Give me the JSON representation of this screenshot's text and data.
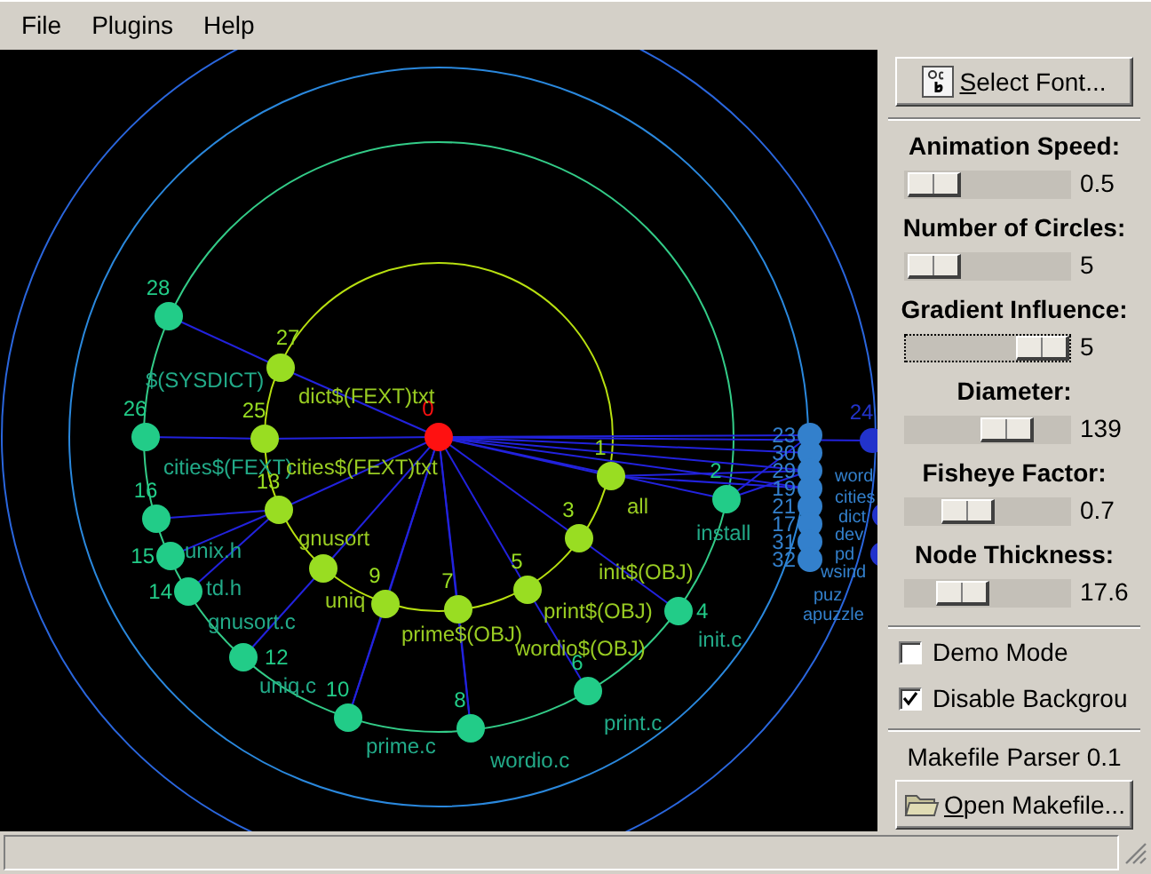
{
  "menu": [
    {
      "label": "File"
    },
    {
      "label": "Plugins"
    },
    {
      "label": "Help"
    }
  ],
  "graph": {
    "nodes": [
      {
        "number": "0",
        "color": "#ff1111"
      },
      {
        "number": "28",
        "color": "#22cc88"
      },
      {
        "number": "27",
        "color": "#99dd22"
      },
      {
        "number": "26",
        "color": "#22cc88"
      },
      {
        "number": "25",
        "color": "#99dd22"
      },
      {
        "number": "13",
        "color": "#99dd22"
      },
      {
        "number": "16",
        "color": "#22cc88"
      },
      {
        "number": "15",
        "color": "#22cc88"
      },
      {
        "number": "14",
        "color": "#22cc88"
      },
      {
        "color": "#99dd22"
      },
      {
        "number": "12",
        "color": "#22cc88"
      },
      {
        "number": "9",
        "color": "#99dd22"
      },
      {
        "number": "7",
        "color": "#99dd22"
      },
      {
        "number": "5",
        "color": "#99dd22"
      },
      {
        "number": "3",
        "color": "#99dd22"
      },
      {
        "number": "1",
        "color": "#99dd22"
      },
      {
        "number": "2",
        "color": "#22cc88"
      },
      {
        "number": "4",
        "color": "#22cc88"
      },
      {
        "number": "6",
        "color": "#22cc88"
      },
      {
        "number": "8",
        "color": "#22cc88"
      },
      {
        "number": "10",
        "color": "#22cc88"
      },
      {
        "number": "23",
        "color": "#3380cc"
      },
      {
        "number": "30",
        "color": "#3380cc"
      },
      {
        "number": "29",
        "color": "#3380cc"
      },
      {
        "number": "19",
        "color": "#3380cc"
      },
      {
        "number": "21",
        "color": "#3380cc"
      },
      {
        "number": "17",
        "color": "#3380cc"
      },
      {
        "number": "31",
        "color": "#3380cc"
      },
      {
        "number": "32",
        "color": "#3380cc"
      },
      {
        "number": "24",
        "color": "#2233cc"
      },
      {
        "color": "#2233cc"
      },
      {
        "color": "#2233cc"
      }
    ],
    "labels": [
      {
        "text": "$(SYSDICT)",
        "color": "#22aa88"
      },
      {
        "text": "dict$(FEXT)txt",
        "color": "#99cc22"
      },
      {
        "text": "cities$(FEXT)",
        "color": "#22aa88"
      },
      {
        "text": "cities$(FEXT)txt",
        "color": "#99cc22"
      },
      {
        "text": "unix.h",
        "color": "#22aa88"
      },
      {
        "text": "td.h",
        "color": "#22aa88"
      },
      {
        "text": "gnusort",
        "color": "#99cc22"
      },
      {
        "text": "gnusort.c",
        "color": "#22aa88"
      },
      {
        "text": "uniq",
        "color": "#99cc22"
      },
      {
        "text": "uniq.c",
        "color": "#22aa88"
      },
      {
        "text": "all",
        "color": "#99cc22"
      },
      {
        "text": "init$(OBJ)",
        "color": "#99cc22"
      },
      {
        "text": "print$(OBJ)",
        "color": "#99cc22"
      },
      {
        "text": "prime$(OBJ)",
        "color": "#99cc22"
      },
      {
        "text": "wordio$(OBJ)",
        "color": "#99cc22"
      },
      {
        "text": "install",
        "color": "#22aa88"
      },
      {
        "text": "init.c",
        "color": "#22aa88"
      },
      {
        "text": "print.c",
        "color": "#22aa88"
      },
      {
        "text": "wordio.c",
        "color": "#22aa88"
      },
      {
        "text": "prime.c",
        "color": "#22aa88"
      },
      {
        "text": "word",
        "color": "#3380cc"
      },
      {
        "text": "cities",
        "color": "#3380cc"
      },
      {
        "text": "dict",
        "color": "#3380cc"
      },
      {
        "text": "dev",
        "color": "#3380cc"
      },
      {
        "text": "pd",
        "color": "#3380cc"
      },
      {
        "text": "wsind",
        "color": "#3380cc"
      },
      {
        "text": "puz",
        "color": "#3380cc"
      },
      {
        "text": "apuzzle",
        "color": "#3380cc"
      }
    ]
  },
  "panel": {
    "font_button": "Select Font...",
    "sliders": [
      {
        "label": "Animation Speed:",
        "level": 0.02,
        "reading": "0.5",
        "focused": false
      },
      {
        "label": "Number of Circles:",
        "level": 0.02,
        "reading": "5",
        "focused": false
      },
      {
        "label": "Gradient Influence:",
        "level": 1,
        "reading": "5",
        "focused": true
      },
      {
        "label": "Diameter:",
        "level": 0.68,
        "reading": "139",
        "focused": false
      },
      {
        "label": "Fisheye Factor:",
        "level": 0.32,
        "reading": "0.7",
        "focused": false
      },
      {
        "label": "Node Thickness:",
        "level": 0.28,
        "reading": "17.6",
        "focused": false
      }
    ],
    "checkboxes": [
      {
        "label": "Demo Mode",
        "checked": false
      },
      {
        "label": "Disable Backgrou",
        "checked": true
      }
    ],
    "plugin_title": "Makefile Parser 0.1",
    "open_button": "Open Makefile..."
  }
}
